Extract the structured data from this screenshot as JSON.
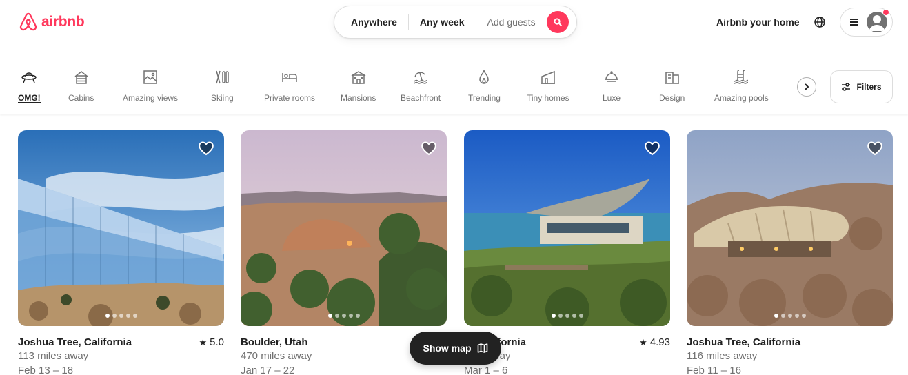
{
  "header": {
    "brand": "airbnb",
    "search": {
      "where": "Anywhere",
      "when": "Any week",
      "guests": "Add guests"
    },
    "host_link": "Airbnb your home"
  },
  "categories": [
    {
      "label": "OMG!",
      "icon": "ufo-icon",
      "active": true
    },
    {
      "label": "Cabins",
      "icon": "cabin-icon"
    },
    {
      "label": "Amazing views",
      "icon": "views-icon"
    },
    {
      "label": "Skiing",
      "icon": "skiing-icon"
    },
    {
      "label": "Private rooms",
      "icon": "bed-icon"
    },
    {
      "label": "Mansions",
      "icon": "mansion-icon"
    },
    {
      "label": "Beachfront",
      "icon": "beach-icon"
    },
    {
      "label": "Trending",
      "icon": "flame-icon"
    },
    {
      "label": "Tiny homes",
      "icon": "tiny-home-icon"
    },
    {
      "label": "Luxe",
      "icon": "luxe-icon"
    },
    {
      "label": "Design",
      "icon": "design-icon"
    },
    {
      "label": "Amazing pools",
      "icon": "pool-icon"
    }
  ],
  "filters_label": "Filters",
  "listings": [
    {
      "location": "Joshua Tree, California",
      "rating": "5.0",
      "distance": "113 miles away",
      "dates": "Feb 13 – 18"
    },
    {
      "location": "Boulder, Utah",
      "rating": "",
      "distance": "470 miles away",
      "dates": "Jan 17 – 22"
    },
    {
      "location": "     California",
      "rating": "4.93",
      "distance": "     s away",
      "dates": "Mar 1 – 6"
    },
    {
      "location": "Joshua Tree, California",
      "rating": "",
      "distance": "116 miles away",
      "dates": "Feb 11 – 16"
    }
  ],
  "show_map_label": "Show map",
  "colors": {
    "brand": "#ff385c",
    "text": "#222222",
    "muted": "#717171"
  }
}
